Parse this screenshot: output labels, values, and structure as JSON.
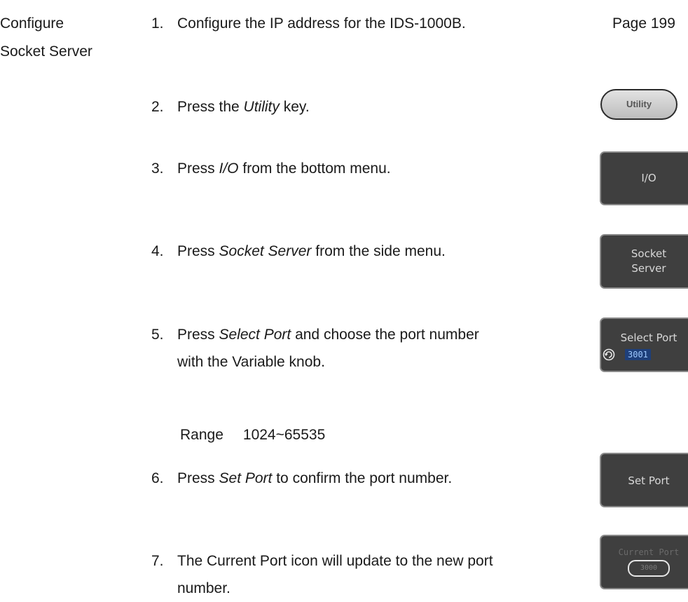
{
  "section": {
    "title_line1": "Configure",
    "title_line2": "Socket Server"
  },
  "reference": "Page 199",
  "steps": [
    {
      "num": "1.",
      "text": "Configure the IP address for the IDS-1000B."
    },
    {
      "num": "2.",
      "pre": "Press the ",
      "em": "Utility",
      "post": " key."
    },
    {
      "num": "3.",
      "pre": "Press ",
      "em": "I/O",
      "post": " from the bottom menu."
    },
    {
      "num": "4.",
      "pre": "Press ",
      "em": "Socket Server",
      "post": " from the side menu."
    },
    {
      "num": "5.",
      "pre": "Press ",
      "em": "Select Port",
      "post": " and choose the port number",
      "line2": "with the Variable knob."
    },
    {
      "num": "6.",
      "pre": "Press ",
      "em": "Set Port",
      "post": " to confirm the port number."
    },
    {
      "num": "7.",
      "text": "The Current Port icon will update to the new port",
      "line2": "number."
    }
  ],
  "range": {
    "label": "Range",
    "value": "1024~65535"
  },
  "buttons": {
    "utility": "Utility",
    "io": "I/O",
    "socket_server_line1": "Socket",
    "socket_server_line2": "Server",
    "select_port_label": "Select Port",
    "select_port_value": "3001",
    "set_port": "Set Port",
    "current_port_label": "Current Port",
    "current_port_value": "3000"
  },
  "icons": {
    "knob": "variable-knob-icon"
  }
}
